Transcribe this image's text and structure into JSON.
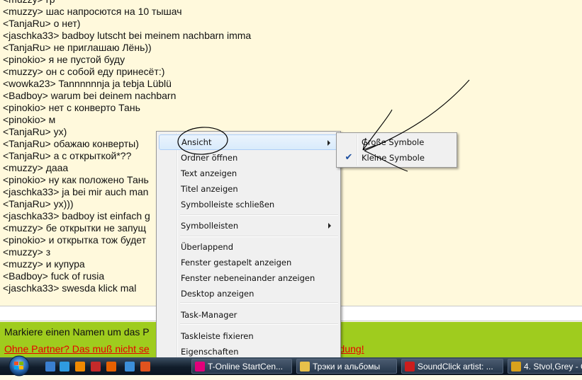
{
  "chat": {
    "lines": [
      "<muzzy> гр",
      "<muzzy> шас напросются на 10 тышач",
      "<TanjaRu> о нет)",
      "<jaschka33> badboy lutscht bei meinem nachbarn imma",
      "<TanjaRu> не приглашаю Лёнь))",
      "<pinokio> я не пустой буду",
      "<muzzy> он с собой еду принесёт:)",
      "<wowka23> Tannnnnnja ja tebja Lüblü",
      "<Badboy> warum bei deinem nachbarn",
      "<pinokio> нет с конверто Тань",
      "<pinokio> м",
      "<TanjaRu> ух)",
      "<TanjaRu> обажаю конверты)",
      "<TanjaRu> а с открыткой*??",
      "<muzzy> дааа",
      "<pinokio> ну как  положено Тань",
      "<jaschka33> ja bei mir auch man",
      "<TanjaRu> ух)))",
      "<jaschka33> badboy ist einfach g",
      "<muzzy> бе открытки не запущ",
      "<pinokio> и открытка тож будет",
      "<muzzy> з",
      "<muzzy> и купура",
      "<Badboy> fuck of rusia",
      "<jaschka33> swesda klick mal"
    ],
    "input_value": ""
  },
  "info_bar": {
    "line1": "Markiere einen Namen um das P",
    "line2": "Ohne Partner? Das muß nicht se",
    "line2_tail": "meldung!"
  },
  "context_menu": {
    "items": [
      {
        "label": "Ansicht",
        "submenu": true,
        "highlighted": true
      },
      {
        "label": "Ordner öffnen"
      },
      {
        "label": "Text anzeigen"
      },
      {
        "label": "Titel anzeigen"
      },
      {
        "label": "Symbolleiste schließen"
      },
      {
        "label": "Symbolleisten",
        "submenu": true
      },
      {
        "label": "Überlappend"
      },
      {
        "label": "Fenster gestapelt anzeigen"
      },
      {
        "label": "Fenster nebeneinander anzeigen"
      },
      {
        "label": "Desktop anzeigen"
      },
      {
        "label": "Task-Manager"
      },
      {
        "label": "Taskleiste fixieren"
      },
      {
        "label": "Eigenschaften"
      }
    ]
  },
  "submenu": {
    "items": [
      {
        "label": "Große Symbole",
        "checked": false
      },
      {
        "label": "Kleine Symbole",
        "checked": true
      }
    ],
    "check_glyph": "✔"
  },
  "taskbar": {
    "buttons": [
      {
        "label": "T-Online StartCen...",
        "icon": "t-online-icon",
        "color": "#e2007a"
      },
      {
        "label": "Трэки и альбомы",
        "icon": "folder-icon",
        "color": "#e8c14a"
      },
      {
        "label": "SoundClick artist: ...",
        "icon": "opera-icon",
        "color": "#cc1d1d"
      },
      {
        "label": "4. Stvol,Grey - O...",
        "icon": "player-icon",
        "color": "#d9a21c"
      }
    ],
    "quick_launch": [
      {
        "icon": "desktop-icon",
        "color": "#3a7fd0"
      },
      {
        "icon": "media-icon",
        "color": "#2f9be0"
      },
      {
        "icon": "player-icon",
        "color": "#f08a00"
      },
      {
        "icon": "music-icon",
        "color": "#c52a2a"
      },
      {
        "icon": "firefox-icon",
        "color": "#e66000"
      },
      {
        "icon": "ie-icon",
        "color": "#3c8fd9"
      },
      {
        "icon": "browser-icon",
        "color": "#e0531e"
      }
    ]
  },
  "colors": {
    "chat_bg": "#fff9dc",
    "info_bar_bg": "#9fcc1e",
    "link_red": "#e60000",
    "annotation": "#000000"
  }
}
